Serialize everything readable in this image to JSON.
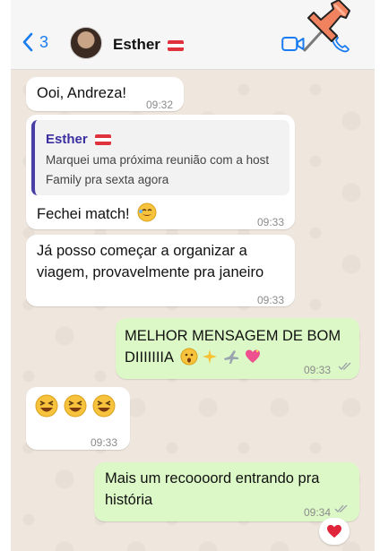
{
  "header": {
    "back_count": "3",
    "contact_name": "Esther"
  },
  "messages": [
    {
      "text": "Ooi, Andreza!",
      "time": "09:32"
    },
    {
      "quoted_author": "Esther",
      "quoted_text": "Marquei uma próxima reunião com a host Family pra sexta agora",
      "text": "Fechei match!",
      "time": "09:33"
    },
    {
      "text": "Já posso começar a organizar a viagem, provavelmente pra janeiro",
      "time": "09:33"
    },
    {
      "text": "MELHOR MENSAGEM DE BOM DIIIIIIIA",
      "time": "09:33"
    },
    {
      "time": "09:33"
    },
    {
      "text": "Mais um recoooord entrando pra história",
      "time": "09:34"
    }
  ],
  "reaction": "heart",
  "colors": {
    "accent_blue": "#1a7cf0",
    "outgoing_bubble": "#dcf8c6",
    "incoming_bubble": "#ffffff",
    "chat_background": "#efe7de"
  }
}
